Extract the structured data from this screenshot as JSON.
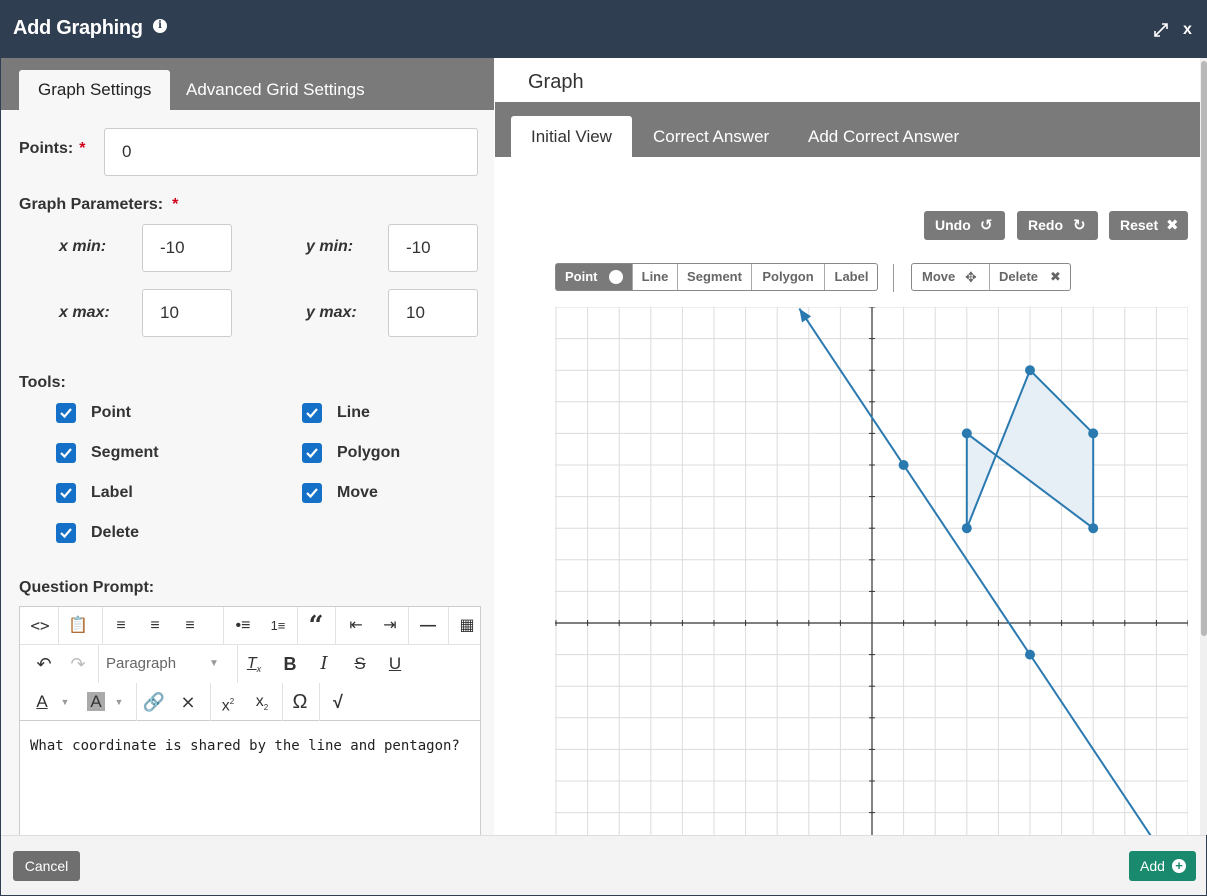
{
  "dialog": {
    "title": "Add Graphing"
  },
  "left_tabs": [
    "Graph Settings",
    "Advanced Grid Settings"
  ],
  "settings": {
    "points_label": "Points:",
    "points_value": "0",
    "graph_parameters_label": "Graph Parameters:",
    "required_mark": "*",
    "x_min_label": "x min:",
    "x_min": "-10",
    "x_max_label": "x max:",
    "x_max": "10",
    "y_min_label": "y min:",
    "y_min": "-10",
    "y_max_label": "y max:",
    "y_max": "10"
  },
  "tools_label": "Tools:",
  "tools": [
    {
      "label": "Point",
      "checked": true
    },
    {
      "label": "Line",
      "checked": true
    },
    {
      "label": "Segment",
      "checked": true
    },
    {
      "label": "Polygon",
      "checked": true
    },
    {
      "label": "Label",
      "checked": true
    },
    {
      "label": "Move",
      "checked": true
    },
    {
      "label": "Delete",
      "checked": true
    }
  ],
  "prompt": {
    "label": "Question Prompt:",
    "format_select": "Paragraph",
    "text": "What coordinate is shared by the line and pentagon?"
  },
  "graph": {
    "heading": "Graph",
    "tabs": [
      "Initial View",
      "Correct Answer",
      "Add Correct Answer"
    ],
    "actions": {
      "undo": "Undo",
      "redo": "Redo",
      "reset": "Reset"
    },
    "draw_tools": [
      "Point",
      "Line",
      "Segment",
      "Polygon",
      "Label"
    ],
    "edit_tools": [
      "Move",
      "Delete"
    ],
    "accent_color": "#2a7ab0",
    "polygon_fill": "#e6eef6"
  },
  "chart_data": {
    "type": "scatter",
    "xlim": [
      -10,
      10
    ],
    "ylim": [
      -10,
      10
    ],
    "grid": true,
    "line": {
      "through": [
        [
          1,
          5
        ],
        [
          5,
          -1
        ]
      ]
    },
    "points": [
      [
        1,
        5
      ],
      [
        5,
        -1
      ]
    ],
    "polygon": [
      [
        3,
        3
      ],
      [
        5,
        8
      ],
      [
        7,
        6
      ],
      [
        7,
        3
      ],
      [
        3,
        6
      ]
    ]
  },
  "footer": {
    "cancel": "Cancel",
    "add": "Add"
  }
}
